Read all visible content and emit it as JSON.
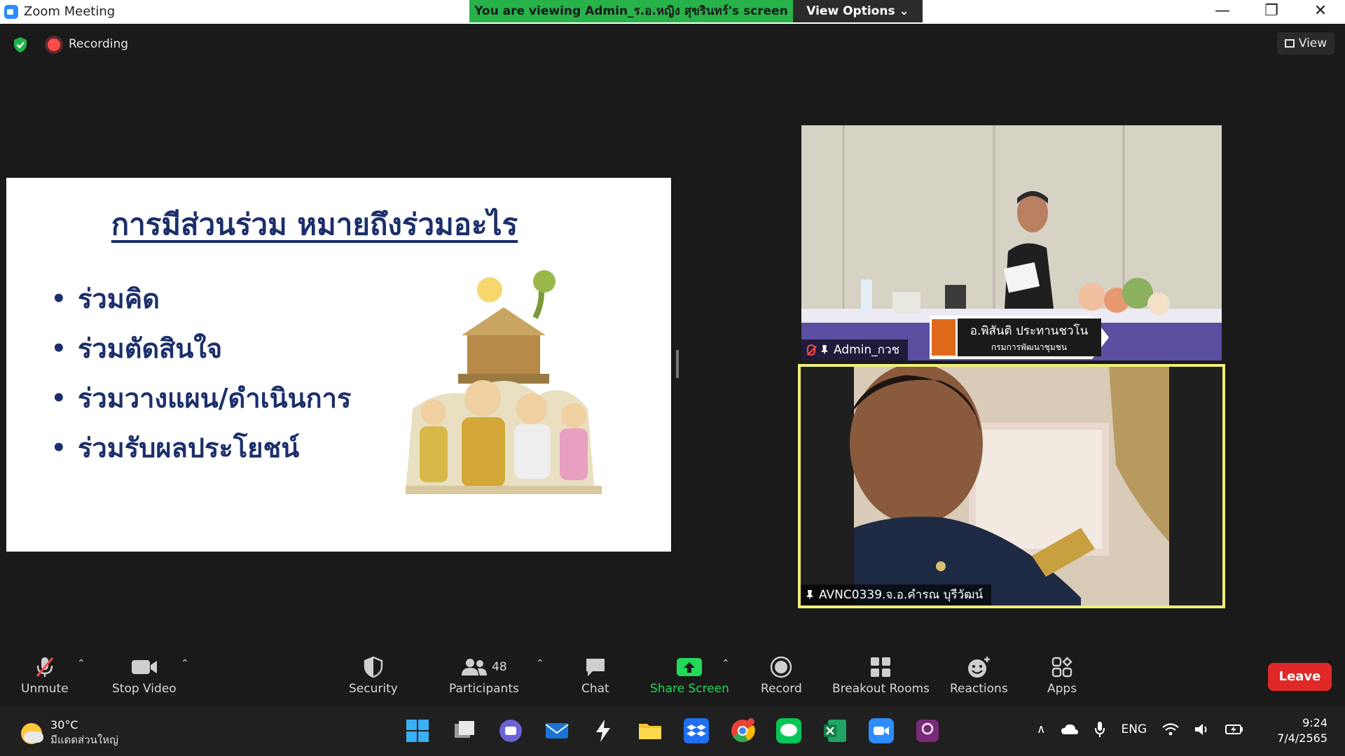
{
  "window": {
    "title": "Zoom Meeting",
    "banner": "You are viewing Admin_ร.อ.หญิง สุขรินทร์'s screen",
    "view_options": "View Options ⌄",
    "controls": {
      "minimize": "—",
      "restore": "❐",
      "close": "✕"
    }
  },
  "meeting": {
    "recording_label": "Recording",
    "view_label": "View"
  },
  "slide": {
    "title": "การมีส่วนร่วม หมายถึงร่วมอะไร",
    "bullets": [
      "ร่วมคิด",
      "ร่วมตัดสินใจ",
      "ร่วมวางแผน/ดำเนินการ",
      "ร่วมรับผลประโยชน์"
    ]
  },
  "videos": [
    {
      "name": "Admin_กวช",
      "lower_third_name": "อ.พิสันติ ประทานชวโน",
      "lower_third_org": "กรมการพัฒนาชุมชน"
    },
    {
      "name": "AVNC0339.จ.อ.คำรณ บุรีวัฒน์"
    }
  ],
  "toolbar": {
    "unmute": "Unmute",
    "stop_video": "Stop Video",
    "security": "Security",
    "participants": "Participants",
    "participants_count": "48",
    "chat": "Chat",
    "share_screen": "Share Screen",
    "record": "Record",
    "breakout_rooms": "Breakout Rooms",
    "reactions": "Reactions",
    "apps": "Apps",
    "leave": "Leave"
  },
  "taskbar": {
    "weather_temp": "30°C",
    "weather_desc": "มีแดดส่วนใหญ่",
    "language": "ENG",
    "time": "9:24",
    "date": "7/4/2565"
  },
  "colors": {
    "banner_green": "#27b24a",
    "share_green": "#23d959",
    "leave_red": "#e02828",
    "active_speaker_border": "#f0f07a",
    "slide_text": "#1c2e6b"
  }
}
